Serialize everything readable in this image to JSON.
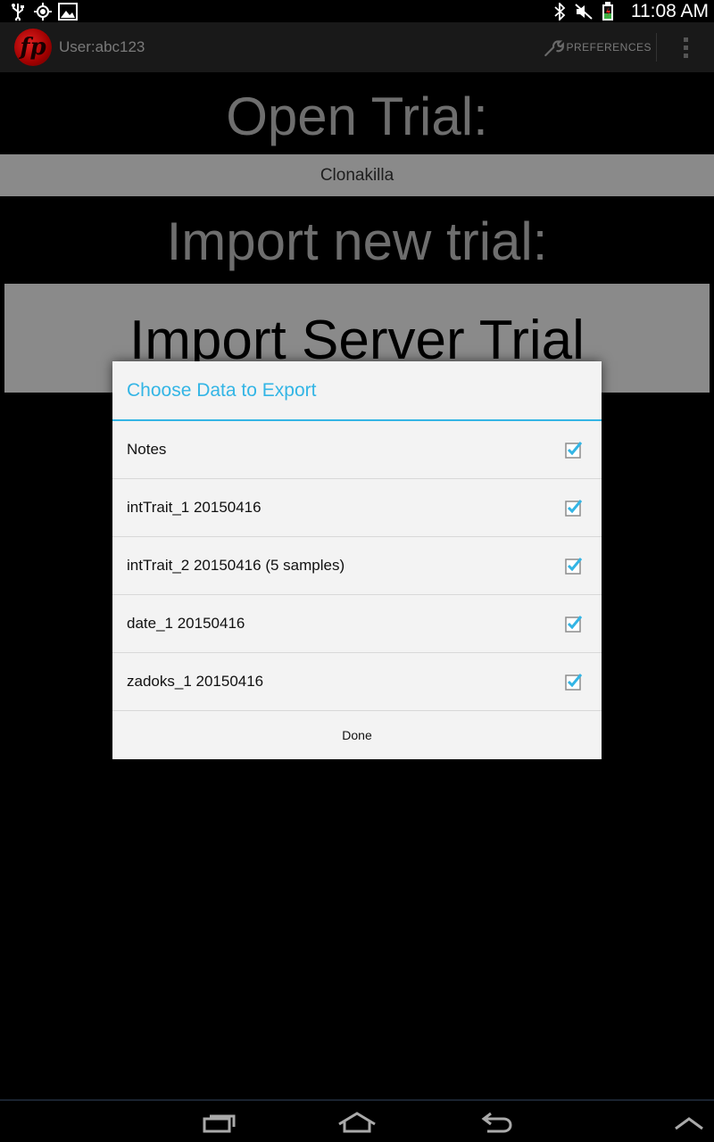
{
  "status_bar": {
    "time": "11:08 AM",
    "left_icons": [
      "usb-icon",
      "gps-icon",
      "image-icon"
    ],
    "right_icons": [
      "bluetooth-icon",
      "muted-icon",
      "battery-charging-icon"
    ]
  },
  "action_bar": {
    "user_label": "User:abc123",
    "preferences_label": "PREFERENCES",
    "logo_letters": "fp"
  },
  "main": {
    "open_trial_heading": "Open Trial:",
    "current_trial": "Clonakilla",
    "import_heading": "Import new trial:",
    "import_server_button": "Import Server Trial"
  },
  "dialog": {
    "title": "Choose Data to Export",
    "items": [
      {
        "label": "Notes",
        "checked": true
      },
      {
        "label": "intTrait_1 20150416",
        "checked": true
      },
      {
        "label": "intTrait_2 20150416 (5 samples)",
        "checked": true
      },
      {
        "label": "date_1 20150416",
        "checked": true
      },
      {
        "label": "zadoks_1 20150416",
        "checked": true
      }
    ],
    "done_label": "Done"
  },
  "colors": {
    "accent": "#33b5e5",
    "dialog_bg": "#f3f3f3",
    "button_gray": "#8a8a8a",
    "heading_gray": "#6e6e6e"
  },
  "nav_bar": {
    "icons": [
      "recent-apps-icon",
      "home-icon",
      "back-icon",
      "chevron-up-icon"
    ]
  }
}
